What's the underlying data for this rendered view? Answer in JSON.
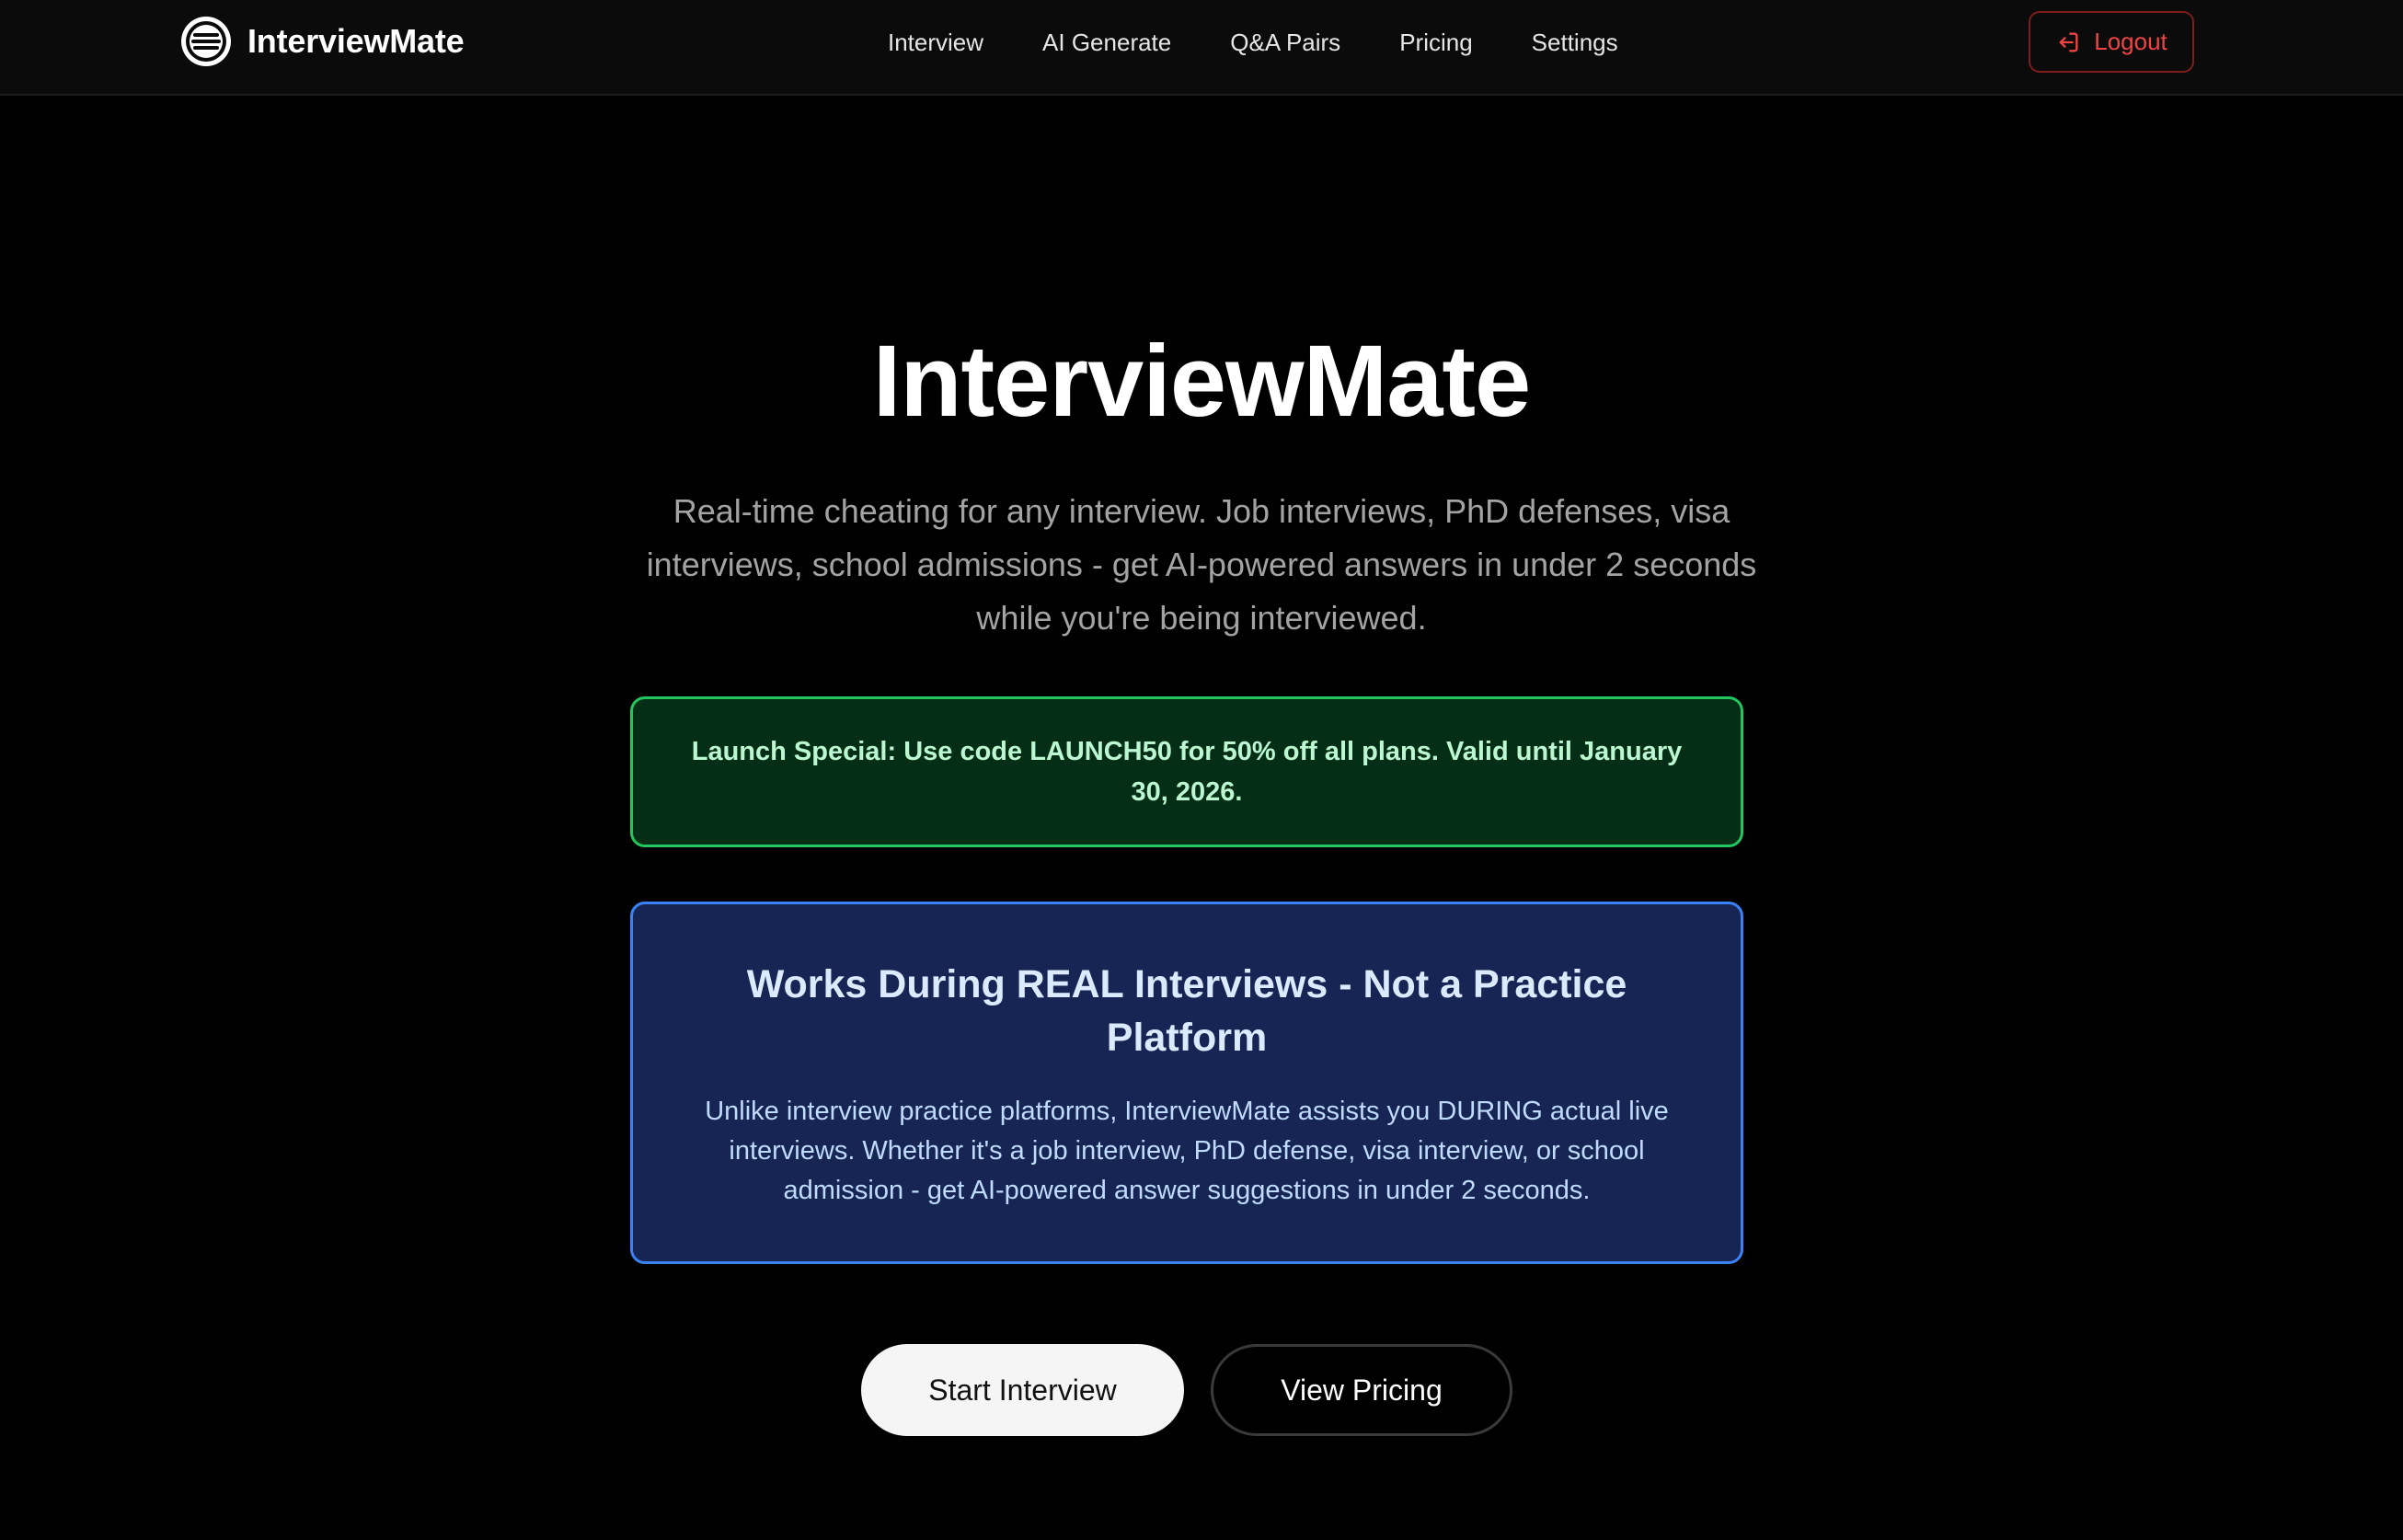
{
  "navbar": {
    "brand_name": "InterviewMate",
    "logo_icon": "interviewmate-logo",
    "links": [
      {
        "label": "Interview"
      },
      {
        "label": "AI Generate"
      },
      {
        "label": "Q&A Pairs"
      },
      {
        "label": "Pricing"
      },
      {
        "label": "Settings"
      }
    ],
    "logout": {
      "label": "Logout",
      "icon": "logout-icon",
      "color": "#ef4444"
    }
  },
  "hero": {
    "title": "InterviewMate",
    "subtitle": "Real-time cheating for any interview. Job interviews, PhD defenses, visa interviews, school admissions - get AI-powered answers in under 2 seconds while you're being interviewed."
  },
  "promo": {
    "text": "Launch Special: Use code LAUNCH50 for 50% off all plans. Valid until January 30, 2026.",
    "border_color": "#22c55e",
    "background_color": "#052e16"
  },
  "info": {
    "title": "Works During REAL Interviews - Not a Practice Platform",
    "body": "Unlike interview practice platforms, InterviewMate assists you DURING actual live interviews. Whether it's a job interview, PhD defense, visa interview, or school admission - get AI-powered answer suggestions in under 2 seconds.",
    "border_color": "#3b82f6",
    "background_color": "#172554"
  },
  "cta": {
    "primary_label": "Start Interview",
    "secondary_label": "View Pricing"
  },
  "colors": {
    "page_background": "#000000",
    "navbar_background": "#0b0b0c",
    "accent_danger": "#ef4444"
  }
}
